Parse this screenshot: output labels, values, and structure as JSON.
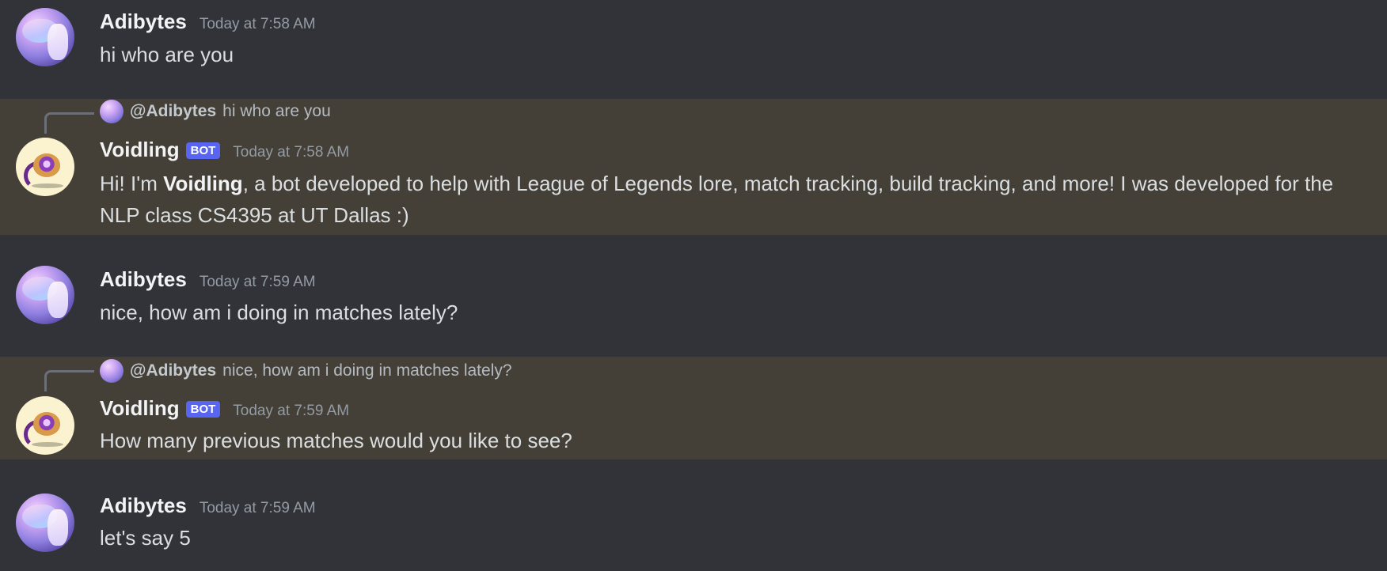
{
  "messages": [
    {
      "author": "Adibytes",
      "timestamp": "Today at 7:58 AM",
      "text": "hi who are you"
    },
    {
      "author": "Voidling",
      "bot_tag": "BOT",
      "timestamp": "Today at 7:58 AM",
      "reply": {
        "mention": "@Adibytes",
        "text": "hi who are you"
      },
      "text_before": "Hi! I'm ",
      "text_bold": "Voidling",
      "text_after": ", a bot developed to help with League of Legends lore, match tracking, build tracking, and more! I was developed for the NLP class CS4395 at UT Dallas :)"
    },
    {
      "author": "Adibytes",
      "timestamp": "Today at 7:59 AM",
      "text": "nice, how am i doing in matches lately?"
    },
    {
      "author": "Voidling",
      "bot_tag": "BOT",
      "timestamp": "Today at 7:59 AM",
      "reply": {
        "mention": "@Adibytes",
        "text": "nice, how am i doing in matches lately?"
      },
      "text": "How many previous matches would you like to see?"
    },
    {
      "author": "Adibytes",
      "timestamp": "Today at 7:59 AM",
      "text": "let's say 5"
    }
  ],
  "colors": {
    "background": "#313338",
    "highlight": "#444037",
    "bot_tag": "#5865f2",
    "timestamp": "#949ba4"
  },
  "icons": {
    "user_avatar": "adibytes-avatar",
    "bot_avatar": "voidling-avatar"
  }
}
